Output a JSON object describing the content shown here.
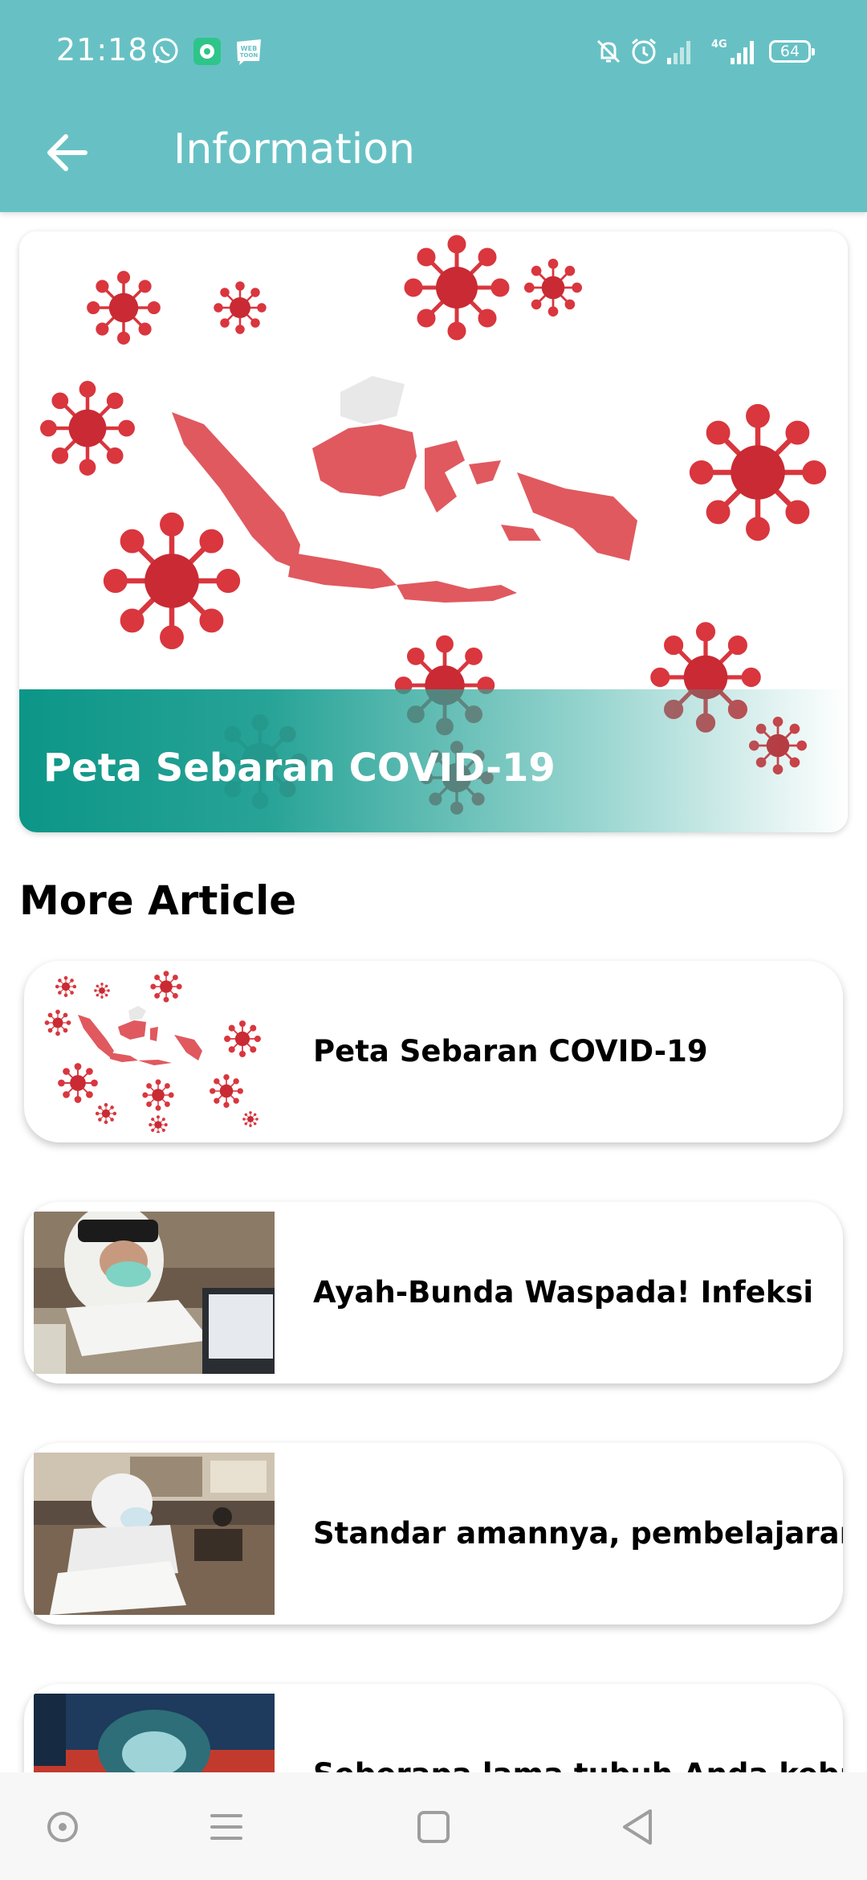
{
  "status_bar": {
    "time": "21:18",
    "battery": "64",
    "network": "4G",
    "icons": [
      "whatsapp-icon",
      "chat-app-icon",
      "webtoon-icon",
      "mute-icon",
      "alarm-icon",
      "signal-icon",
      "signal-4g-icon",
      "battery-icon"
    ]
  },
  "app_bar": {
    "title": "Information",
    "back_icon": "arrow-left-icon"
  },
  "hero": {
    "title": "Peta Sebaran COVID-19",
    "image": "covid-map-indonesia"
  },
  "more": {
    "heading": "More Article"
  },
  "articles": [
    {
      "title": "Peta Sebaran COVID-19",
      "image": "covid-map-indonesia"
    },
    {
      "title": "Ayah-Bunda Waspada! Infeksi",
      "image": "student-mask-photo"
    },
    {
      "title": "Standar amannya, pembelajaran",
      "image": "classroom-exam-photo"
    },
    {
      "title": "Seberapa lama tubuh Anda kebal",
      "image": "oxygen-mask-photo"
    }
  ],
  "nav_bar": {
    "items": [
      "assistant-dot-icon",
      "menu-icon",
      "home-square-icon",
      "back-triangle-icon"
    ]
  },
  "colors": {
    "primary": "#67c1c4",
    "hero_overlay": "#0c9687",
    "virus": "#d9363e",
    "map": "#e0595f"
  }
}
